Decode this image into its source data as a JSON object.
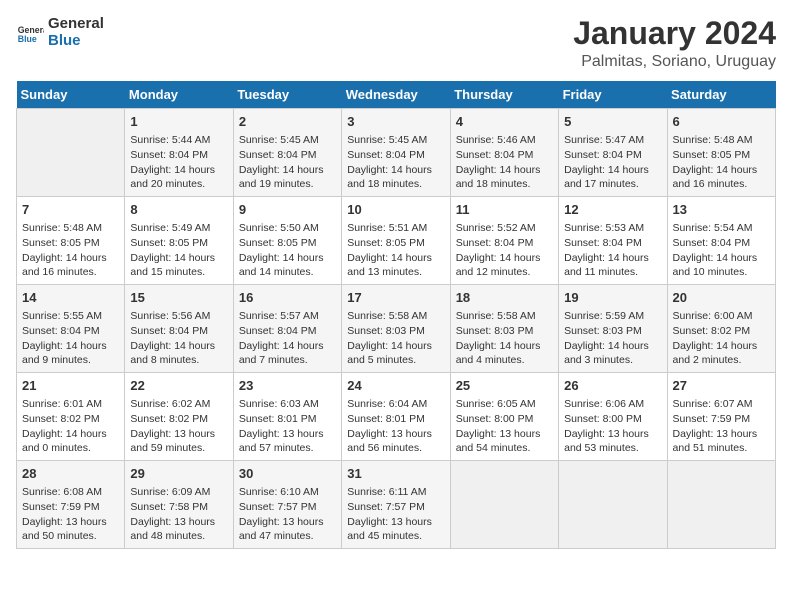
{
  "logo": {
    "text_general": "General",
    "text_blue": "Blue"
  },
  "header": {
    "title": "January 2024",
    "subtitle": "Palmitas, Soriano, Uruguay"
  },
  "weekdays": [
    "Sunday",
    "Monday",
    "Tuesday",
    "Wednesday",
    "Thursday",
    "Friday",
    "Saturday"
  ],
  "weeks": [
    [
      {
        "day": "",
        "info": ""
      },
      {
        "day": "1",
        "info": "Sunrise: 5:44 AM\nSunset: 8:04 PM\nDaylight: 14 hours\nand 20 minutes."
      },
      {
        "day": "2",
        "info": "Sunrise: 5:45 AM\nSunset: 8:04 PM\nDaylight: 14 hours\nand 19 minutes."
      },
      {
        "day": "3",
        "info": "Sunrise: 5:45 AM\nSunset: 8:04 PM\nDaylight: 14 hours\nand 18 minutes."
      },
      {
        "day": "4",
        "info": "Sunrise: 5:46 AM\nSunset: 8:04 PM\nDaylight: 14 hours\nand 18 minutes."
      },
      {
        "day": "5",
        "info": "Sunrise: 5:47 AM\nSunset: 8:04 PM\nDaylight: 14 hours\nand 17 minutes."
      },
      {
        "day": "6",
        "info": "Sunrise: 5:48 AM\nSunset: 8:05 PM\nDaylight: 14 hours\nand 16 minutes."
      }
    ],
    [
      {
        "day": "7",
        "info": "Sunrise: 5:48 AM\nSunset: 8:05 PM\nDaylight: 14 hours\nand 16 minutes."
      },
      {
        "day": "8",
        "info": "Sunrise: 5:49 AM\nSunset: 8:05 PM\nDaylight: 14 hours\nand 15 minutes."
      },
      {
        "day": "9",
        "info": "Sunrise: 5:50 AM\nSunset: 8:05 PM\nDaylight: 14 hours\nand 14 minutes."
      },
      {
        "day": "10",
        "info": "Sunrise: 5:51 AM\nSunset: 8:05 PM\nDaylight: 14 hours\nand 13 minutes."
      },
      {
        "day": "11",
        "info": "Sunrise: 5:52 AM\nSunset: 8:04 PM\nDaylight: 14 hours\nand 12 minutes."
      },
      {
        "day": "12",
        "info": "Sunrise: 5:53 AM\nSunset: 8:04 PM\nDaylight: 14 hours\nand 11 minutes."
      },
      {
        "day": "13",
        "info": "Sunrise: 5:54 AM\nSunset: 8:04 PM\nDaylight: 14 hours\nand 10 minutes."
      }
    ],
    [
      {
        "day": "14",
        "info": "Sunrise: 5:55 AM\nSunset: 8:04 PM\nDaylight: 14 hours\nand 9 minutes."
      },
      {
        "day": "15",
        "info": "Sunrise: 5:56 AM\nSunset: 8:04 PM\nDaylight: 14 hours\nand 8 minutes."
      },
      {
        "day": "16",
        "info": "Sunrise: 5:57 AM\nSunset: 8:04 PM\nDaylight: 14 hours\nand 7 minutes."
      },
      {
        "day": "17",
        "info": "Sunrise: 5:58 AM\nSunset: 8:03 PM\nDaylight: 14 hours\nand 5 minutes."
      },
      {
        "day": "18",
        "info": "Sunrise: 5:58 AM\nSunset: 8:03 PM\nDaylight: 14 hours\nand 4 minutes."
      },
      {
        "day": "19",
        "info": "Sunrise: 5:59 AM\nSunset: 8:03 PM\nDaylight: 14 hours\nand 3 minutes."
      },
      {
        "day": "20",
        "info": "Sunrise: 6:00 AM\nSunset: 8:02 PM\nDaylight: 14 hours\nand 2 minutes."
      }
    ],
    [
      {
        "day": "21",
        "info": "Sunrise: 6:01 AM\nSunset: 8:02 PM\nDaylight: 14 hours\nand 0 minutes."
      },
      {
        "day": "22",
        "info": "Sunrise: 6:02 AM\nSunset: 8:02 PM\nDaylight: 13 hours\nand 59 minutes."
      },
      {
        "day": "23",
        "info": "Sunrise: 6:03 AM\nSunset: 8:01 PM\nDaylight: 13 hours\nand 57 minutes."
      },
      {
        "day": "24",
        "info": "Sunrise: 6:04 AM\nSunset: 8:01 PM\nDaylight: 13 hours\nand 56 minutes."
      },
      {
        "day": "25",
        "info": "Sunrise: 6:05 AM\nSunset: 8:00 PM\nDaylight: 13 hours\nand 54 minutes."
      },
      {
        "day": "26",
        "info": "Sunrise: 6:06 AM\nSunset: 8:00 PM\nDaylight: 13 hours\nand 53 minutes."
      },
      {
        "day": "27",
        "info": "Sunrise: 6:07 AM\nSunset: 7:59 PM\nDaylight: 13 hours\nand 51 minutes."
      }
    ],
    [
      {
        "day": "28",
        "info": "Sunrise: 6:08 AM\nSunset: 7:59 PM\nDaylight: 13 hours\nand 50 minutes."
      },
      {
        "day": "29",
        "info": "Sunrise: 6:09 AM\nSunset: 7:58 PM\nDaylight: 13 hours\nand 48 minutes."
      },
      {
        "day": "30",
        "info": "Sunrise: 6:10 AM\nSunset: 7:57 PM\nDaylight: 13 hours\nand 47 minutes."
      },
      {
        "day": "31",
        "info": "Sunrise: 6:11 AM\nSunset: 7:57 PM\nDaylight: 13 hours\nand 45 minutes."
      },
      {
        "day": "",
        "info": ""
      },
      {
        "day": "",
        "info": ""
      },
      {
        "day": "",
        "info": ""
      }
    ]
  ]
}
